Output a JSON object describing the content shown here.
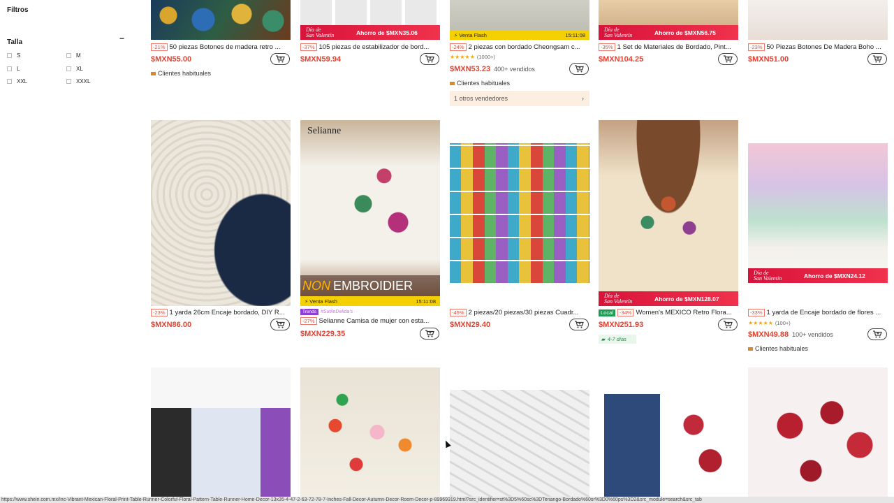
{
  "sidebar": {
    "filters_title": "Filtros",
    "size_title": "Talla",
    "sizes": [
      "S",
      "M",
      "L",
      "XL",
      "XXL",
      "XXXL"
    ]
  },
  "common": {
    "dia_line1": "Día de",
    "dia_line2": "San Valentín",
    "flash_label": "Venta Flash",
    "flash_time": "15:11:08",
    "clientes": "Clientes habituales"
  },
  "row1": [
    {
      "discount": "-21%",
      "title": "50 piezas Botones de madera retro ...",
      "price": "$MXN55.00",
      "badge": "Clientes habituales"
    },
    {
      "discount": "-37%",
      "title": "105 piezas de estabilizador de bord...",
      "price": "$MXN59.94",
      "promo": "Ahorro de $MXN35.06"
    },
    {
      "discount": "-24%",
      "title": "2 piezas con bordado Cheongsam c...",
      "price": "$MXN53.23",
      "sold": "400+ vendidos",
      "rating_count": "(1000+)",
      "badge": "Clientes habituales",
      "sellers": "1 otros vendedores"
    },
    {
      "discount": "-35%",
      "title": "1 Set de Materiales de Bordado, Pint...",
      "price": "$MXN104.25",
      "promo": "Ahorro de $MXN56.75"
    },
    {
      "discount": "-23%",
      "title": "50 Piezas Botones De Madera Boho ...",
      "price": "$MXN51.00"
    }
  ],
  "row2": [
    {
      "discount": "-23%",
      "title": "1 yarda 26cm Encaje bordado, DIY R...",
      "price": "$MXN86.00"
    },
    {
      "brand": "Selianne",
      "banner_word1": "NON",
      "banner_word2": "EMBROIDIER",
      "trends_tag": "Trends",
      "trends_sub": "#SutileDelida's",
      "discount": "-27%",
      "title": "Selianne Camisa de mujer con esta...",
      "price": "$MXN229.35"
    },
    {
      "discount": "-45%",
      "title": "2 piezas/20 piezas/30 piezas Cuadr...",
      "price": "$MXN29.40"
    },
    {
      "local": "Local",
      "discount": "-34%",
      "title": "Women's MEXICO Retro Flora...",
      "price": "$MXN251.93",
      "ship": "4-7 días",
      "promo": "Ahorro de $MXN128.07"
    },
    {
      "discount": "-33%",
      "title": "1 yarda de Encaje bordado de flores ...",
      "price": "$MXN49.88",
      "sold": "100+ vendidos",
      "rating_count": "(100+)",
      "badge": "Clientes habituales",
      "promo": "Ahorro de $MXN24.12"
    }
  ],
  "status_url": "https://www.shein.com.mx/Inc-Vibrant-Mexican-Floral-Print-Table-Runner-Colorful-Floral-Pattern-Table-Runner-Home-Decor-13x35-4-47-2-63-72-78-7-Inches-Fall-Decor-Autumn-Decor-Room-Decor-p-89969319.html?src_identifier=st%3D5%60sc%3DTenango-Bordado%60sr%3D0%60ps%3D2&src_module=search&src_tab"
}
